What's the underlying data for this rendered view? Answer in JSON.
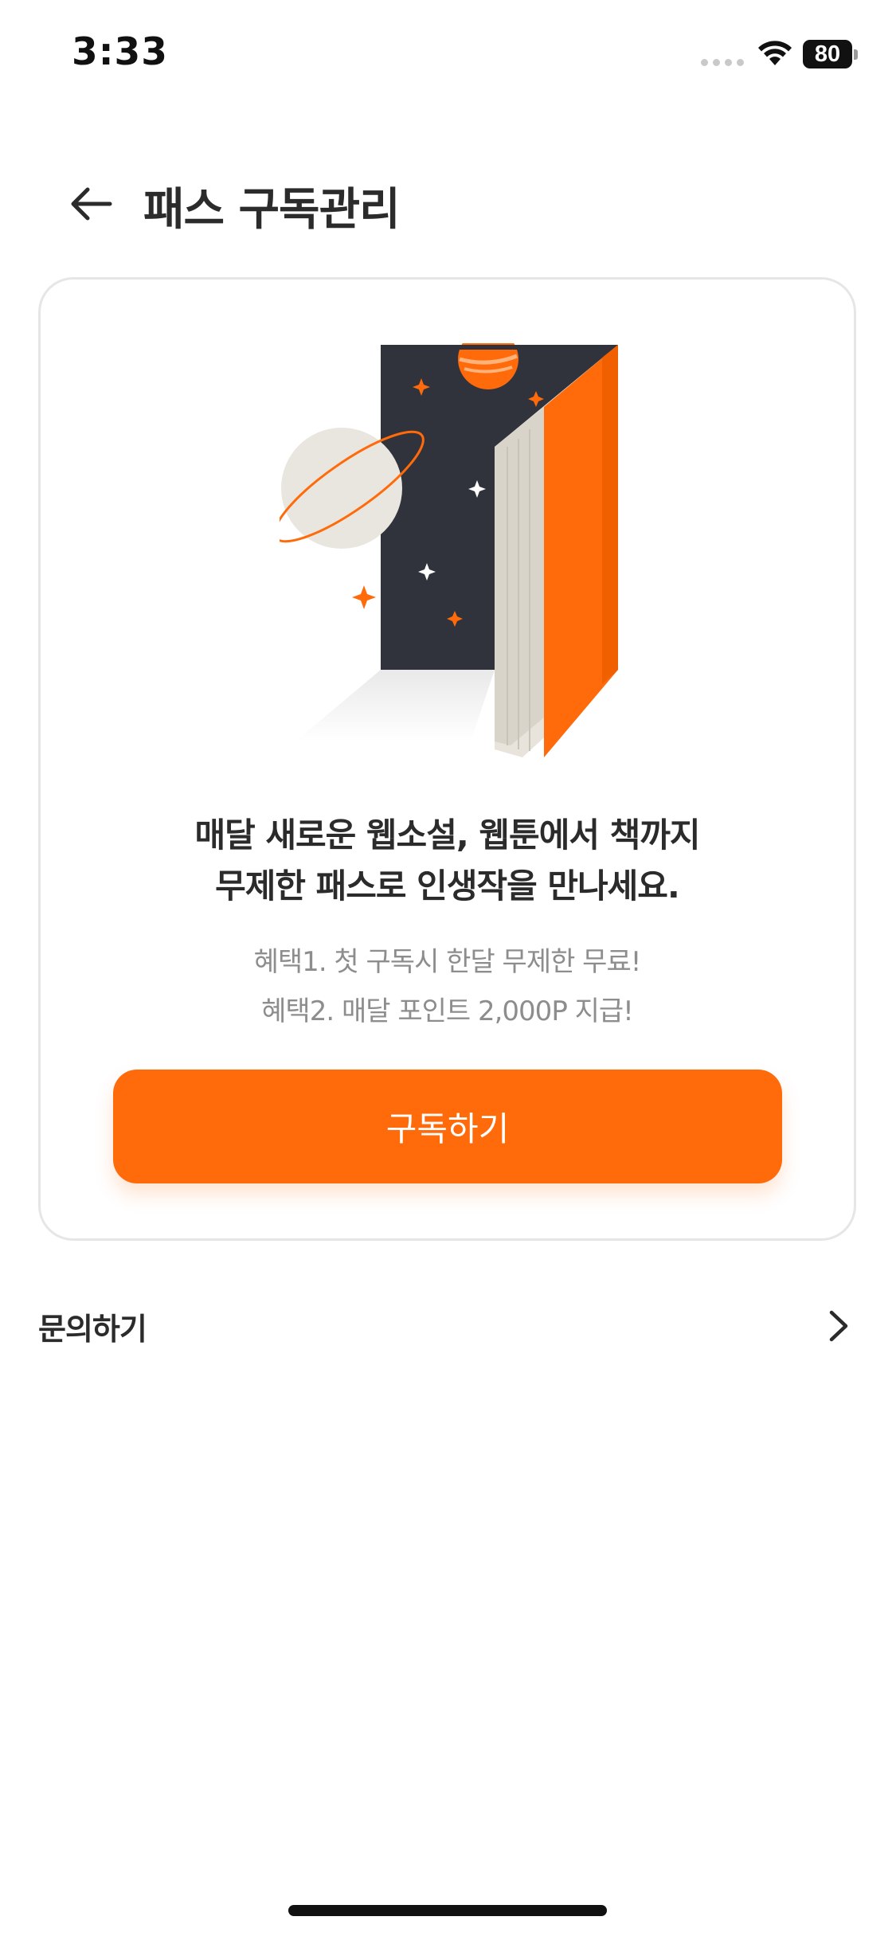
{
  "status_bar": {
    "time": "3:33",
    "battery": "80"
  },
  "header": {
    "title": "패스 구독관리"
  },
  "card": {
    "headline_line1": "매달 새로운 웹소설, 웹툰에서 책까지",
    "headline_line2": "무제한 패스로 인생작을 만나세요.",
    "benefit_1": "혜택1. 첫 구독시 한달 무제한 무료!",
    "benefit_2": "혜택2. 매달 포인트 2,000P 지급!",
    "subscribe_label": "구독하기"
  },
  "inquiry": {
    "label": "문의하기"
  },
  "colors": {
    "accent": "#ff6a0a",
    "text": "#2b2b2b",
    "muted": "#8d8d8d",
    "card_border": "#e6e6e6"
  },
  "icons": {
    "back": "arrow-left-icon",
    "chevron": "chevron-right-icon",
    "wifi": "wifi-icon",
    "battery": "battery-icon"
  }
}
